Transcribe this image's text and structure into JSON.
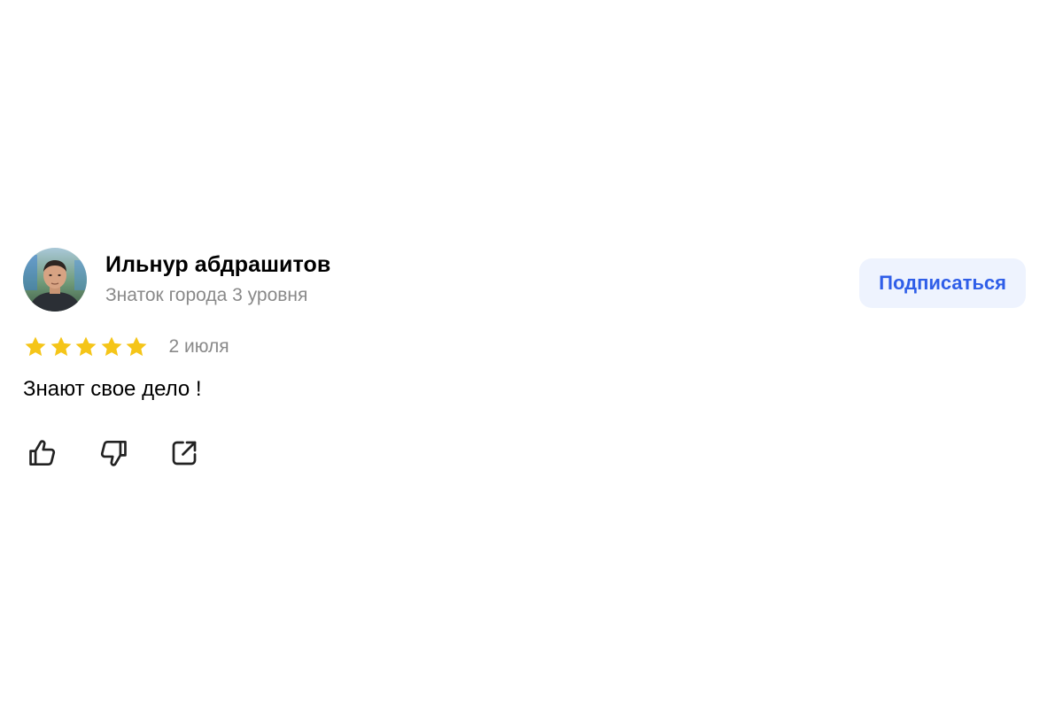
{
  "review": {
    "author": {
      "name": "Ильнур абдрашитов",
      "level": "Знаток города 3 уровня",
      "avatar_icon": "user-photo"
    },
    "subscribe_label": "Подписаться",
    "rating": 5,
    "rating_max": 5,
    "date": "2 июля",
    "text": "Знают свое дело !",
    "actions": [
      {
        "icon": "thumbs-up-icon"
      },
      {
        "icon": "thumbs-down-icon"
      },
      {
        "icon": "share-icon"
      }
    ]
  },
  "colors": {
    "accent": "#2f5ee8",
    "button_bg": "#eef3fe",
    "star": "#f5c518",
    "muted_text": "#898989"
  }
}
